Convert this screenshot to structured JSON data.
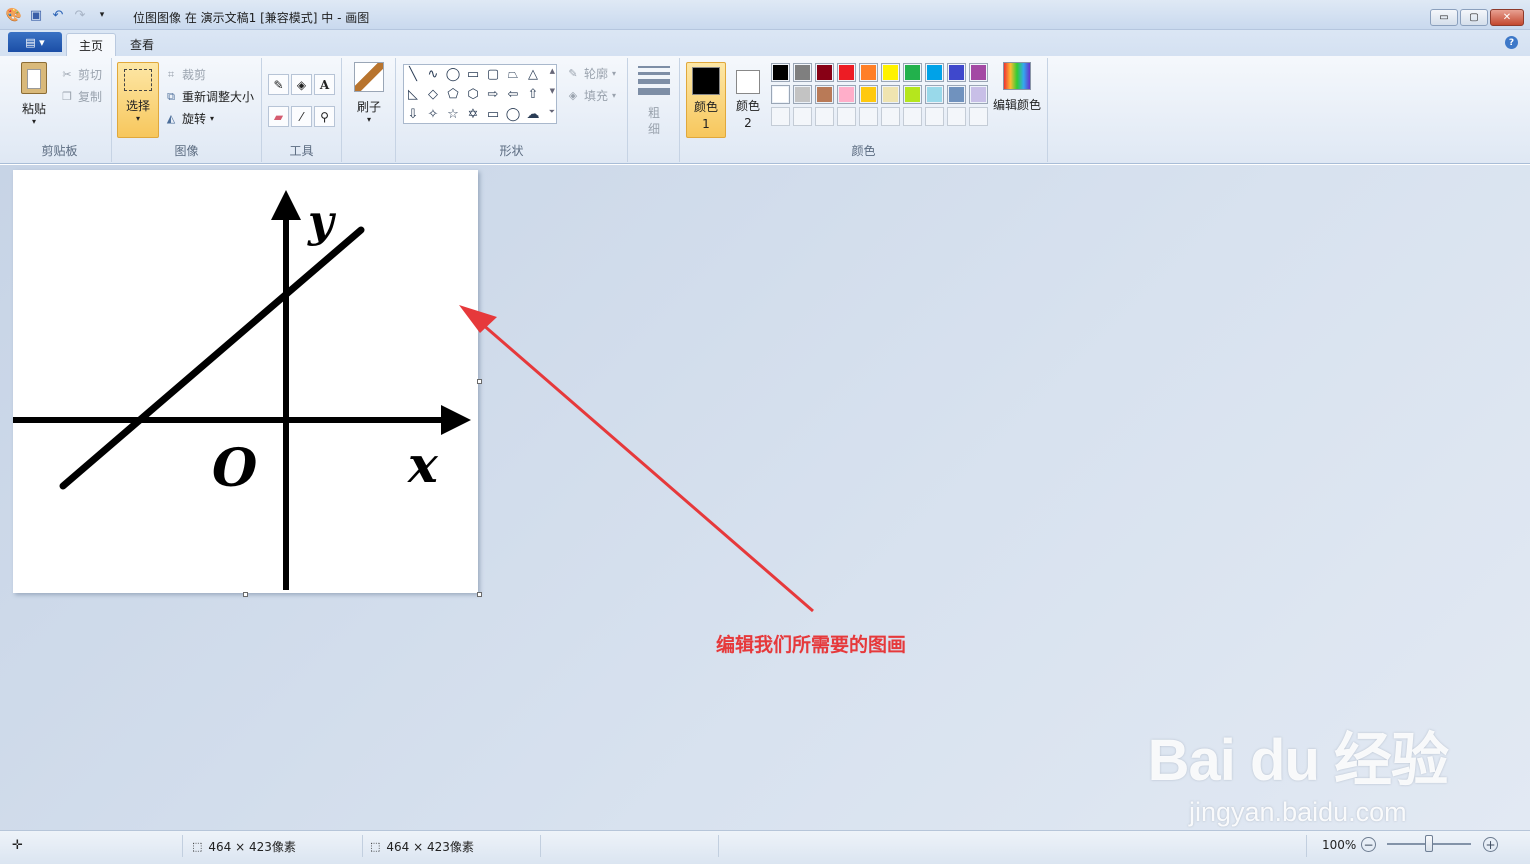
{
  "window": {
    "title": "位图图像 在 演示文稿1 [兼容模式] 中 - 画图",
    "minimize": "▭",
    "maximize": "▢",
    "close": "✕"
  },
  "tabs": {
    "app_menu": "▤ ▾",
    "home": "主页",
    "view": "查看",
    "help": "?"
  },
  "ribbon": {
    "clipboard": {
      "label": "剪贴板",
      "paste": "粘贴",
      "cut": "剪切",
      "copy": "复制"
    },
    "image": {
      "label": "图像",
      "select": "选择",
      "crop": "裁剪",
      "resize": "重新调整大小",
      "rotate": "旋转"
    },
    "tools": {
      "label": "工具"
    },
    "brushes": {
      "label": "刷子"
    },
    "shapes": {
      "label": "形状",
      "outline": "轮廓",
      "fill": "填充"
    },
    "size": {
      "label": "粗细"
    },
    "colors": {
      "label": "颜色",
      "color1": "颜色 1",
      "color2": "颜色 2",
      "edit": "编辑颜色",
      "palette_row1": [
        "#000000",
        "#7f7f7f",
        "#880015",
        "#ed1c24",
        "#ff7f27",
        "#fff200",
        "#22b14c",
        "#00a2e8",
        "#3f48cc",
        "#a349a4"
      ],
      "palette_row2": [
        "#ffffff",
        "#c3c3c3",
        "#b97a57",
        "#ffaec9",
        "#ffc90e",
        "#efe4b0",
        "#b5e61d",
        "#99d9ea",
        "#7092be",
        "#c8bfe7"
      ]
    }
  },
  "canvas": {
    "y_label": "y",
    "x_label": "x",
    "origin_label": "O"
  },
  "annotation": "编辑我们所需要的图画",
  "watermark": {
    "logo": "Bai du 经验",
    "url": "jingyan.baidu.com"
  },
  "status": {
    "selection_size": "464 × 423像素",
    "image_size": "464 × 423像素",
    "zoom": "100%"
  }
}
